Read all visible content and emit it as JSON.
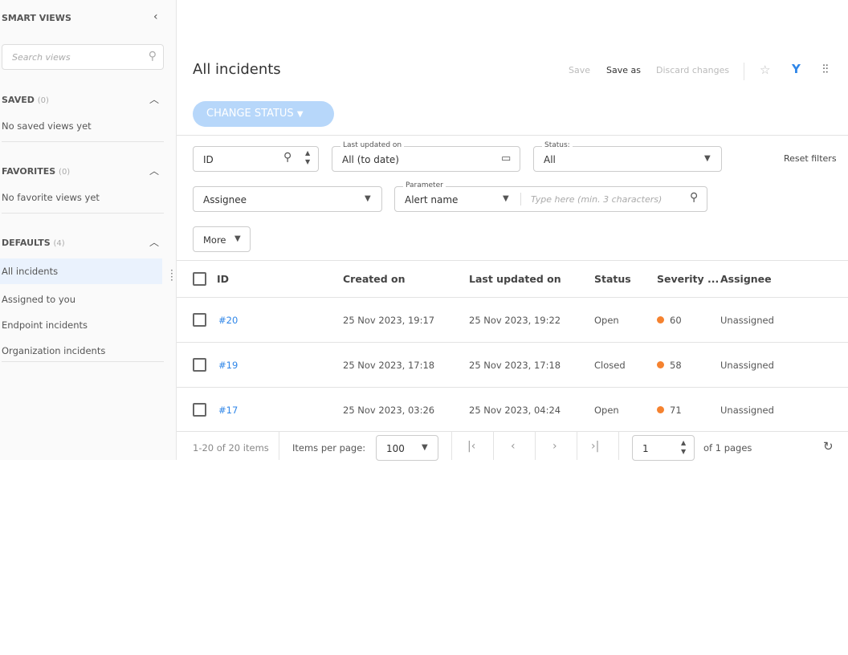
{
  "sidebar": {
    "title": "SMART VIEWS",
    "search_placeholder": "Search views",
    "saved": {
      "label": "SAVED",
      "count": "(0)",
      "empty": "No saved views yet"
    },
    "favorites": {
      "label": "FAVORITES",
      "count": "(0)",
      "empty": "No favorite views yet"
    },
    "defaults": {
      "label": "DEFAULTS",
      "count": "(4)",
      "items": [
        "All incidents",
        "Assigned to you",
        "Endpoint incidents",
        "Organization incidents"
      ]
    }
  },
  "header": {
    "title": "All incidents",
    "save": "Save",
    "save_as": "Save as",
    "discard": "Discard changes",
    "change_status": "CHANGE STATUS"
  },
  "filters": {
    "id": "ID",
    "last_updated_label": "Last updated on",
    "last_updated": "All (to date)",
    "status_label": "Status:",
    "status": "All",
    "reset": "Reset filters",
    "assignee": "Assignee",
    "parameter_label": "Parameter",
    "parameter": "Alert name",
    "param_placeholder": "Type here (min. 3 characters)",
    "more": "More"
  },
  "table": {
    "columns": [
      "ID",
      "Created on",
      "Last updated on",
      "Status",
      "Severity ...",
      "Assignee"
    ],
    "rows": [
      {
        "id": "#20",
        "created": "25 Nov 2023, 19:17",
        "updated": "25 Nov 2023, 19:22",
        "status": "Open",
        "severity": "60",
        "assignee": "Unassigned"
      },
      {
        "id": "#19",
        "created": "25 Nov 2023, 17:18",
        "updated": "25 Nov 2023, 17:18",
        "status": "Closed",
        "severity": "58",
        "assignee": "Unassigned"
      },
      {
        "id": "#17",
        "created": "25 Nov 2023, 03:26",
        "updated": "25 Nov 2023, 04:24",
        "status": "Open",
        "severity": "71",
        "assignee": "Unassigned"
      }
    ],
    "severity_color": "#f5822f",
    "link_color": "#2f86e8"
  },
  "pagination": {
    "range": "1-20 of 20 items",
    "per_page_label": "Items per page:",
    "per_page": "100",
    "page": "1",
    "of_pages": "of 1 pages"
  }
}
